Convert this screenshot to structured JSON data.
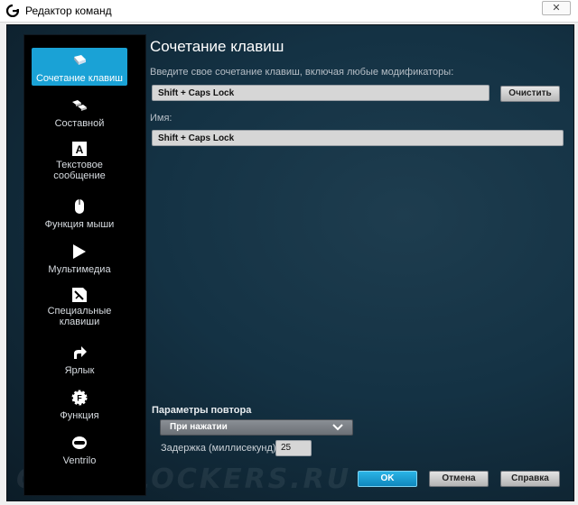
{
  "window": {
    "title": "Редактор команд",
    "close_glyph": "✕"
  },
  "sidebar": {
    "items": [
      {
        "label": "Сочетание клавиш",
        "icon": "key-combo-icon",
        "active": true
      },
      {
        "label": "Составной",
        "icon": "multikey-icon"
      },
      {
        "label": "Текстовое сообщение",
        "icon": "text-block-icon"
      },
      {
        "label": "Функция мыши",
        "icon": "mouse-icon"
      },
      {
        "label": "Мультимедиа",
        "icon": "play-icon"
      },
      {
        "label": "Специальные клавиши",
        "icon": "special-keys-icon"
      },
      {
        "label": "Ярлык",
        "icon": "shortcut-arrow-icon"
      },
      {
        "label": "Функция",
        "icon": "function-gear-icon"
      },
      {
        "label": "Ventrilo",
        "icon": "headset-icon"
      }
    ]
  },
  "main": {
    "title": "Сочетание клавиш",
    "keys_label": "Введите свое сочетание клавиш, включая любые модификаторы:",
    "keys_value": "Shift + Caps Lock",
    "clear_button": "Очистить",
    "name_label": "Имя:",
    "name_value": "Shift + Caps Lock"
  },
  "repeat": {
    "title": "Параметры повтора",
    "mode_value": "При нажатии",
    "delay_label": "Задержка (миллисекунд):",
    "delay_value": "25"
  },
  "footer": {
    "ok": "OK",
    "cancel": "Отмена",
    "help": "Справка"
  },
  "watermark": "OVERCLOCKERS.RU",
  "colors": {
    "accent": "#1aa2d6",
    "background": "#143244"
  }
}
